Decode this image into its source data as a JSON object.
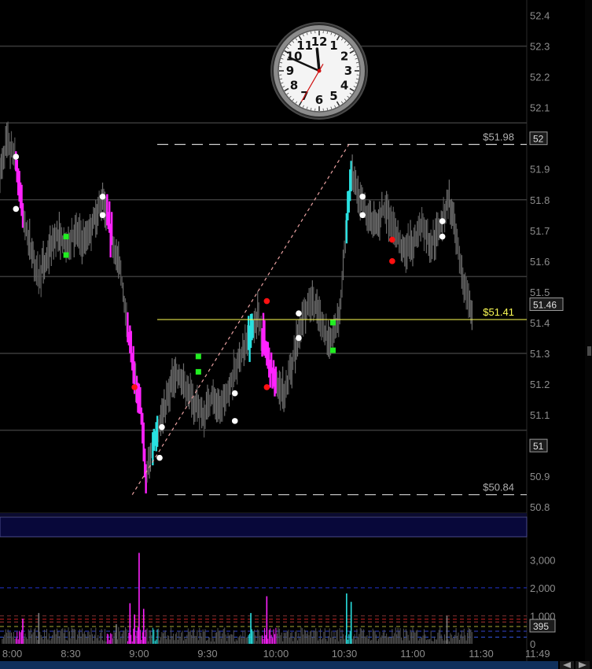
{
  "chart_data": [
    {
      "type": "candlestick",
      "yticks": [
        "52.4",
        "52.3",
        "52.2",
        "52.1",
        "52",
        "51.9",
        "51.8",
        "51.7",
        "51.6",
        "51.5",
        "51.4",
        "51.3",
        "51.2",
        "51.1",
        "51",
        "50.9",
        "50.8"
      ],
      "ylim": [
        50.78,
        52.45
      ],
      "grid_levels": [
        52.3,
        52.05,
        51.8,
        51.55,
        51.3,
        51.05
      ],
      "levels": [
        {
          "label": "$51.98",
          "value": 51.98,
          "style": "dashed"
        },
        {
          "label": "$51.41",
          "value": 51.41,
          "style": "solid"
        },
        {
          "label": "$50.84",
          "value": 50.84,
          "style": "dashed"
        }
      ],
      "axis_boxes": [
        {
          "label": "52",
          "value": 52.0
        },
        {
          "label": "51.46",
          "value": 51.46
        },
        {
          "label": "51",
          "value": 51.0
        }
      ],
      "trend_line": {
        "x1": "8:57",
        "y1": 50.84,
        "x2": "10:32",
        "y2": 51.98
      },
      "xticks": [
        "8:00",
        "8:30",
        "9:00",
        "9:30",
        "10:00",
        "10:30",
        "11:00",
        "11:30",
        "11:49"
      ],
      "x_range": [
        "7:59",
        "11:50"
      ],
      "path": [
        [
          "7:59",
          51.88
        ],
        [
          "8:02",
          51.98
        ],
        [
          "8:06",
          51.93
        ],
        [
          "8:09",
          51.75
        ],
        [
          "8:12",
          51.66
        ],
        [
          "8:16",
          51.55
        ],
        [
          "8:20",
          51.62
        ],
        [
          "8:24",
          51.69
        ],
        [
          "8:28",
          51.65
        ],
        [
          "8:32",
          51.7
        ],
        [
          "8:36",
          51.66
        ],
        [
          "8:40",
          51.73
        ],
        [
          "8:44",
          51.8
        ],
        [
          "8:48",
          51.68
        ],
        [
          "8:52",
          51.56
        ],
        [
          "8:55",
          51.38
        ],
        [
          "8:58",
          51.22
        ],
        [
          "9:01",
          51.1
        ],
        [
          "9:03",
          50.9
        ],
        [
          "9:06",
          51.0
        ],
        [
          "9:09",
          51.08
        ],
        [
          "9:12",
          51.14
        ],
        [
          "9:16",
          51.24
        ],
        [
          "9:20",
          51.2
        ],
        [
          "9:24",
          51.14
        ],
        [
          "9:28",
          51.1
        ],
        [
          "9:32",
          51.16
        ],
        [
          "9:36",
          51.12
        ],
        [
          "9:40",
          51.2
        ],
        [
          "9:44",
          51.28
        ],
        [
          "9:48",
          51.35
        ],
        [
          "9:52",
          51.43
        ],
        [
          "9:56",
          51.3
        ],
        [
          "10:00",
          51.2
        ],
        [
          "10:04",
          51.17
        ],
        [
          "10:08",
          51.3
        ],
        [
          "10:12",
          51.43
        ],
        [
          "10:16",
          51.47
        ],
        [
          "10:20",
          51.4
        ],
        [
          "10:24",
          51.33
        ],
        [
          "10:28",
          51.44
        ],
        [
          "10:31",
          51.72
        ],
        [
          "10:33",
          51.9
        ],
        [
          "10:36",
          51.8
        ],
        [
          "10:40",
          51.75
        ],
        [
          "10:44",
          51.72
        ],
        [
          "10:48",
          51.78
        ],
        [
          "10:52",
          51.7
        ],
        [
          "10:56",
          51.63
        ],
        [
          "11:00",
          51.66
        ],
        [
          "11:04",
          51.72
        ],
        [
          "11:08",
          51.65
        ],
        [
          "11:12",
          51.72
        ],
        [
          "11:16",
          51.8
        ],
        [
          "11:20",
          51.62
        ],
        [
          "11:24",
          51.48
        ],
        [
          "11:26",
          51.44
        ]
      ],
      "highlights": [
        {
          "from": "8:06",
          "to": "8:09",
          "color": "#ff22ff"
        },
        {
          "from": "8:46",
          "to": "8:48",
          "color": "#ff22ff"
        },
        {
          "from": "8:55",
          "to": "8:58",
          "color": "#ff22ff"
        },
        {
          "from": "8:59",
          "to": "9:03",
          "color": "#ff22ff"
        },
        {
          "from": "9:54",
          "to": "10:00",
          "color": "#ff22ff"
        },
        {
          "from": "9:06",
          "to": "9:08",
          "color": "#29e0e0"
        },
        {
          "from": "9:48",
          "to": "9:50",
          "color": "#29e0e0"
        },
        {
          "from": "10:31",
          "to": "10:33",
          "color": "#29e0e0"
        }
      ],
      "markers": [
        {
          "t": "8:06",
          "v": 51.94,
          "shape": "circle",
          "color": "#ffffff"
        },
        {
          "t": "8:06",
          "v": 51.77,
          "shape": "circle",
          "color": "#ffffff"
        },
        {
          "t": "8:44",
          "v": 51.81,
          "shape": "circle",
          "color": "#ffffff"
        },
        {
          "t": "8:44",
          "v": 51.75,
          "shape": "circle",
          "color": "#ffffff"
        },
        {
          "t": "8:28",
          "v": 51.68,
          "shape": "square",
          "color": "#22ee22"
        },
        {
          "t": "8:28",
          "v": 51.62,
          "shape": "square",
          "color": "#22ee22"
        },
        {
          "t": "8:58",
          "v": 51.19,
          "shape": "circle",
          "color": "#ff1111"
        },
        {
          "t": "9:10",
          "v": 51.06,
          "shape": "circle",
          "color": "#ffffff"
        },
        {
          "t": "9:09",
          "v": 50.96,
          "shape": "circle",
          "color": "#ffffff"
        },
        {
          "t": "9:26",
          "v": 51.29,
          "shape": "square",
          "color": "#22ee22"
        },
        {
          "t": "9:26",
          "v": 51.24,
          "shape": "square",
          "color": "#22ee22"
        },
        {
          "t": "9:42",
          "v": 51.17,
          "shape": "circle",
          "color": "#ffffff"
        },
        {
          "t": "9:42",
          "v": 51.08,
          "shape": "circle",
          "color": "#ffffff"
        },
        {
          "t": "9:56",
          "v": 51.47,
          "shape": "circle",
          "color": "#ff1111"
        },
        {
          "t": "9:56",
          "v": 51.19,
          "shape": "circle",
          "color": "#ff1111"
        },
        {
          "t": "10:10",
          "v": 51.43,
          "shape": "circle",
          "color": "#ffffff"
        },
        {
          "t": "10:10",
          "v": 51.35,
          "shape": "circle",
          "color": "#ffffff"
        },
        {
          "t": "10:25",
          "v": 51.4,
          "shape": "square",
          "color": "#22ee22"
        },
        {
          "t": "10:25",
          "v": 51.31,
          "shape": "square",
          "color": "#22ee22"
        },
        {
          "t": "10:38",
          "v": 51.81,
          "shape": "circle",
          "color": "#ffffff"
        },
        {
          "t": "10:38",
          "v": 51.75,
          "shape": "circle",
          "color": "#ffffff"
        },
        {
          "t": "10:51",
          "v": 51.67,
          "shape": "circle",
          "color": "#ff1111"
        },
        {
          "t": "10:51",
          "v": 51.6,
          "shape": "circle",
          "color": "#ff1111"
        },
        {
          "t": "11:13",
          "v": 51.73,
          "shape": "circle",
          "color": "#ffffff"
        },
        {
          "t": "11:13",
          "v": 51.68,
          "shape": "circle",
          "color": "#ffffff"
        }
      ]
    },
    {
      "type": "bar",
      "yticks": [
        "3,000",
        "2,000",
        "1,000",
        "0"
      ],
      "ylim": [
        0,
        3600
      ],
      "last_value_label": "395",
      "reference_levels": [
        {
          "value": 2000,
          "color": "#2233cc"
        },
        {
          "value": 1000,
          "color": "#7a3030"
        },
        {
          "value": 880,
          "color": "#cc2222"
        },
        {
          "value": 780,
          "color": "#aa3333"
        },
        {
          "value": 620,
          "color": "#aaaa33"
        },
        {
          "value": 450,
          "color": "#3344cc"
        },
        {
          "value": 240,
          "color": "#3355dd"
        }
      ],
      "spikes": [
        {
          "t": "8:09",
          "v": 900
        },
        {
          "t": "8:16",
          "v": 1100
        },
        {
          "t": "8:50",
          "v": 700
        },
        {
          "t": "8:56",
          "v": 1450
        },
        {
          "t": "8:58",
          "v": 1050
        },
        {
          "t": "9:00",
          "v": 3250
        },
        {
          "t": "9:02",
          "v": 1250
        },
        {
          "t": "9:49",
          "v": 1100
        },
        {
          "t": "9:56",
          "v": 1700
        },
        {
          "t": "10:31",
          "v": 1800
        },
        {
          "t": "10:33",
          "v": 1500
        },
        {
          "t": "11:15",
          "v": 1000
        }
      ]
    }
  ],
  "clock": {
    "numerals": [
      "12",
      "1",
      "2",
      "3",
      "4",
      "5",
      "6",
      "7",
      "8",
      "9",
      "10",
      "11"
    ],
    "hour": 11,
    "minute": 49,
    "second": 35
  },
  "colors": {
    "accent_magenta": "#ff22ff",
    "accent_cyan": "#29e0e0",
    "level_yellow": "#ffff55",
    "separator_band": "#0a0a3c"
  }
}
